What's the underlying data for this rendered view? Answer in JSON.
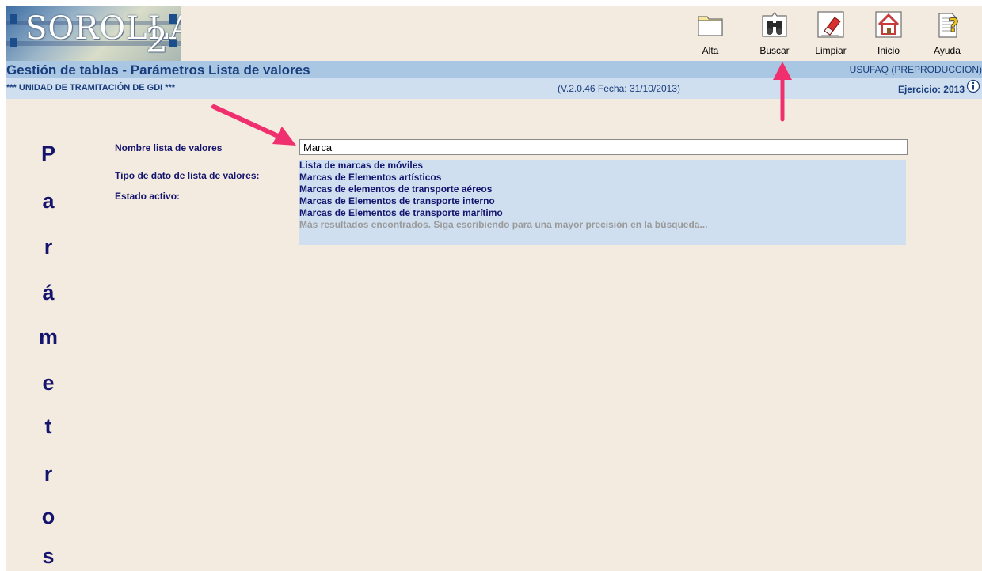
{
  "logo": {
    "name": "SOROLLA",
    "version_number": "2"
  },
  "toolbar": {
    "items": [
      {
        "label": "Alta",
        "icon": "folder-icon"
      },
      {
        "label": "Buscar",
        "icon": "binoculars-icon"
      },
      {
        "label": "Limpiar",
        "icon": "eraser-icon"
      },
      {
        "label": "Inicio",
        "icon": "home-icon"
      },
      {
        "label": "Ayuda",
        "icon": "help-icon"
      }
    ]
  },
  "header": {
    "title": "Gestión de tablas - Parámetros Lista de valores",
    "user": "USUFAQ (PREPRODUCCION)",
    "unit": "*** UNIDAD DE TRAMITACIÓN DE GDI ***",
    "version": "(V.2.0.46 Fecha: 31/10/2013)",
    "ejercicio": "Ejercicio: 2013"
  },
  "side_title": {
    "letters": [
      "P",
      "a",
      "r",
      "á",
      "m",
      "e",
      "t",
      "r",
      "o",
      "s"
    ]
  },
  "form": {
    "nombre_label": "Nombre lista de valores",
    "tipo_label": "Tipo de dato de lista de valores:",
    "estado_label": "Estado activo:",
    "nombre_value": "Marca"
  },
  "autocomplete": {
    "items": [
      "Lista de marcas de móviles",
      "Marcas de Elementos artísticos",
      "Marcas de elementos de transporte aéreos",
      "Marcas de Elementos de transporte interno",
      "Marcas de Elementos de transporte marítimo"
    ],
    "more_results": "Más resultados encontrados. Siga escribiendo para una mayor precisión en la búsqueda..."
  },
  "colors": {
    "background": "#f3ebdf",
    "title_bar": "#a9c6e3",
    "sub_bar": "#cfdff0",
    "text_dark_blue": "#14146e",
    "annotation_arrow": "#f0306e"
  }
}
